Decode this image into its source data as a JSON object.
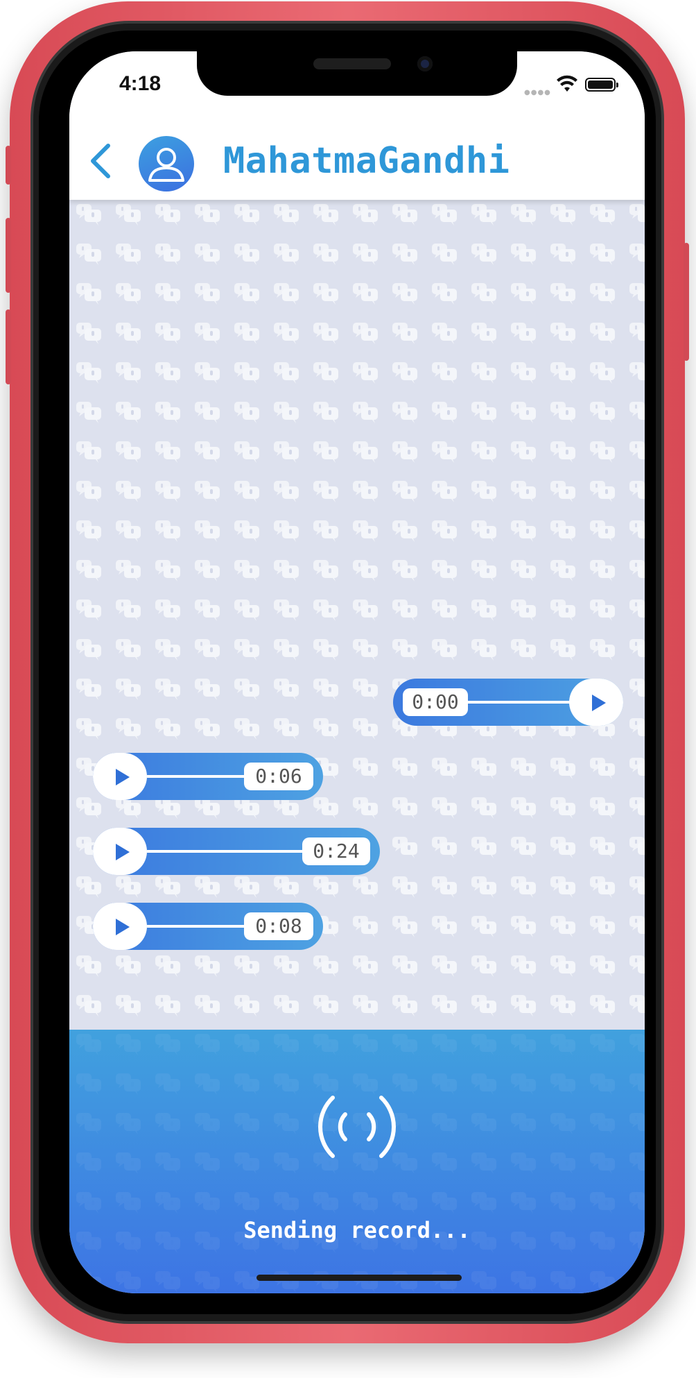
{
  "status_bar": {
    "time": "4:18",
    "signal_icon": "signal-dots-icon",
    "wifi_icon": "wifi-icon",
    "battery_icon": "battery-full-icon"
  },
  "header": {
    "back_icon": "chevron-left-icon",
    "avatar_icon": "person-avatar-icon",
    "contact_name": "MahatmaGandhi"
  },
  "messages": [
    {
      "side": "right",
      "duration": "0:00",
      "play_icon": "play-icon"
    },
    {
      "side": "left",
      "duration": "0:06",
      "play_icon": "play-icon"
    },
    {
      "side": "left",
      "duration": "0:24",
      "play_icon": "play-icon"
    },
    {
      "side": "left",
      "duration": "0:08",
      "play_icon": "play-icon"
    }
  ],
  "recorder": {
    "icon": "broadcast-waves-icon",
    "status_text": "Sending record..."
  },
  "colors": {
    "phone_frame": "#e55f69",
    "accent": "#2e97d8",
    "bubble_start": "#3b79df",
    "bubble_end": "#4ea2e2",
    "recorder_top": "#41a1de",
    "recorder_bottom": "#3d74e4",
    "chat_bg": "#dde1ee"
  }
}
